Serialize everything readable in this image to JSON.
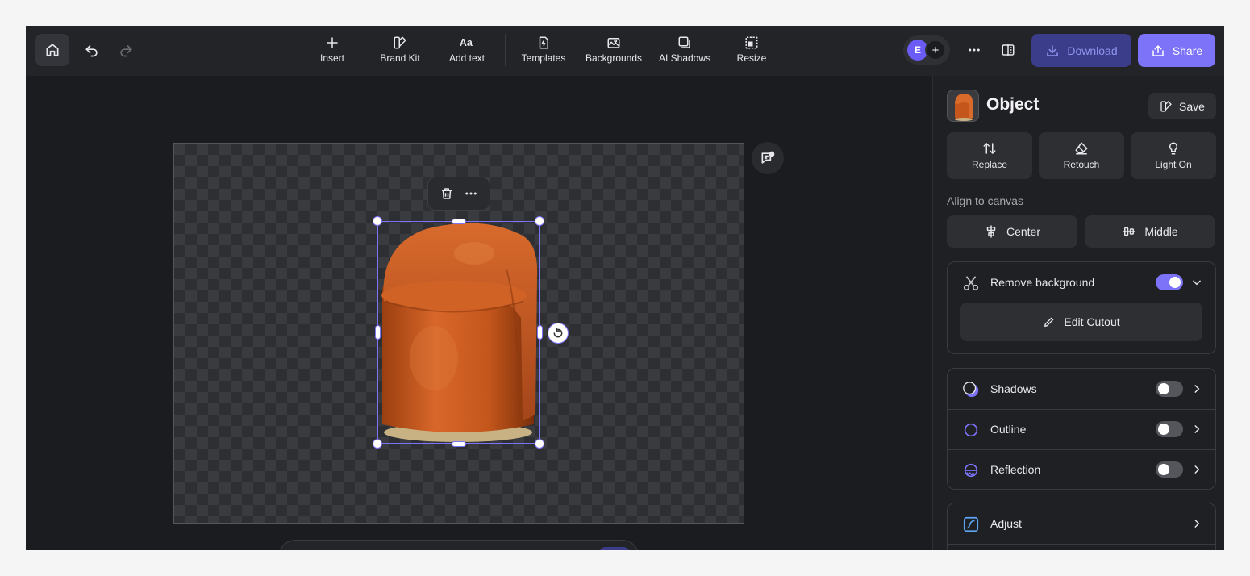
{
  "toolbar": {
    "tools": [
      {
        "label": "Insert",
        "icon": "plus-icon"
      },
      {
        "label": "Brand Kit",
        "icon": "brand-kit-icon"
      },
      {
        "label": "Add text",
        "icon": "text-icon"
      },
      {
        "label": "Templates",
        "icon": "templates-icon"
      },
      {
        "label": "Backgrounds",
        "icon": "backgrounds-icon"
      },
      {
        "label": "AI Shadows",
        "icon": "ai-shadows-icon"
      },
      {
        "label": "Resize",
        "icon": "resize-icon"
      }
    ],
    "avatar_initial": "E",
    "download_label": "Download",
    "share_label": "Share"
  },
  "panel": {
    "title": "Object",
    "save_label": "Save",
    "actions": [
      {
        "label": "Replace",
        "icon": "replace-icon"
      },
      {
        "label": "Retouch",
        "icon": "retouch-icon"
      },
      {
        "label": "Light On",
        "icon": "bulb-icon"
      }
    ],
    "align_label": "Align to canvas",
    "align_center_label": "Center",
    "align_middle_label": "Middle",
    "remove_background": {
      "label": "Remove background",
      "enabled": true,
      "edit_label": "Edit Cutout"
    },
    "effects": [
      {
        "label": "Shadows",
        "enabled": false
      },
      {
        "label": "Outline",
        "enabled": false
      },
      {
        "label": "Reflection",
        "enabled": false
      }
    ],
    "adjust_label": "Adjust"
  },
  "colors": {
    "accent": "#7d73f8",
    "chair": "#c4561c"
  }
}
